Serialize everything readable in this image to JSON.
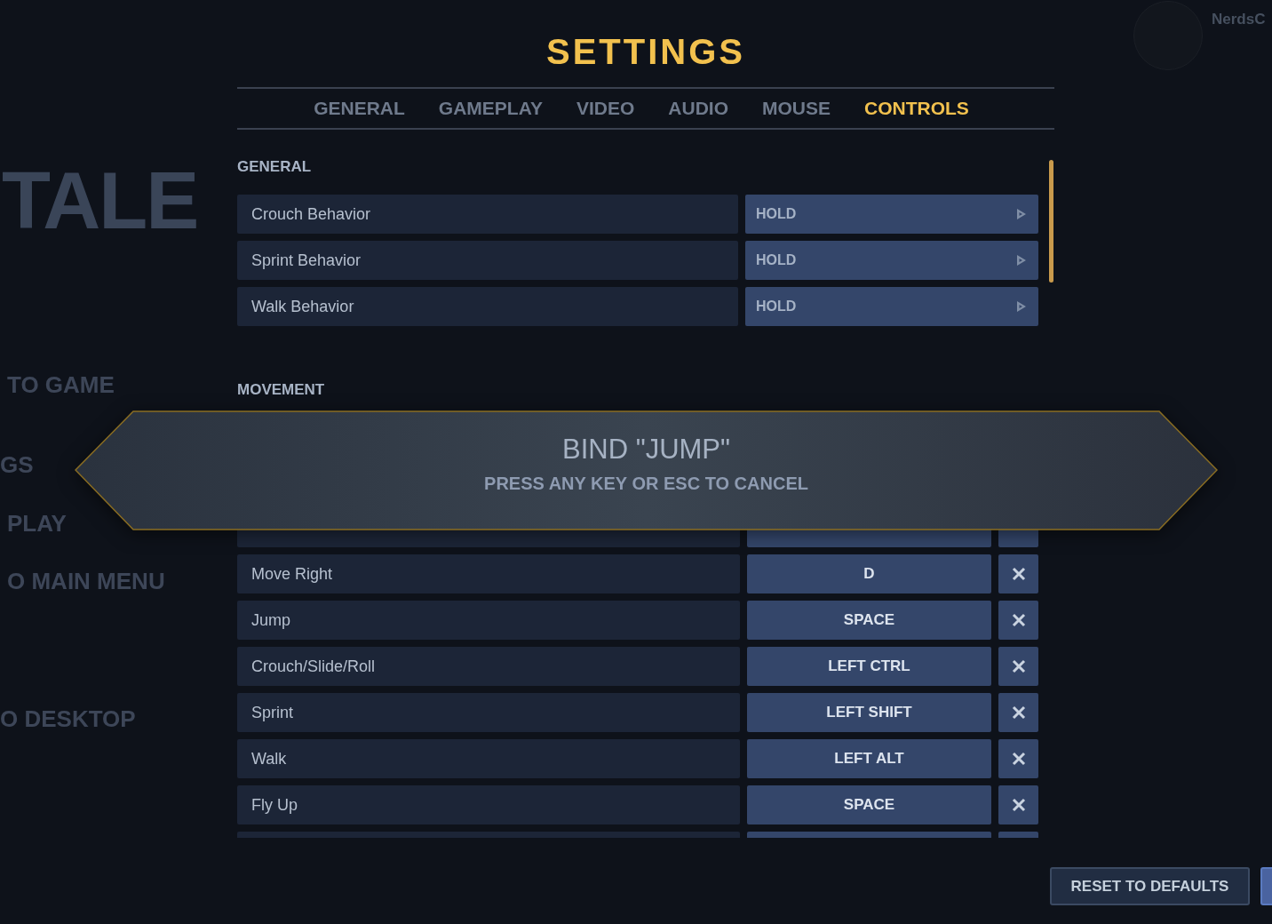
{
  "background": {
    "logo": "TALE",
    "menu": [
      "TO GAME",
      "GS",
      "PLAY",
      "O MAIN MENU",
      "O DESKTOP"
    ],
    "user": "NerdsC"
  },
  "title": "SETTINGS",
  "tabs": [
    {
      "label": "GENERAL",
      "selected": false
    },
    {
      "label": "GAMEPLAY",
      "selected": false
    },
    {
      "label": "VIDEO",
      "selected": false
    },
    {
      "label": "AUDIO",
      "selected": false
    },
    {
      "label": "MOUSE",
      "selected": false
    },
    {
      "label": "CONTROLS",
      "selected": true
    }
  ],
  "sections": [
    {
      "title": "GENERAL",
      "kind": "options",
      "rows": [
        {
          "label": "Crouch Behavior",
          "value": "HOLD"
        },
        {
          "label": "Sprint Behavior",
          "value": "HOLD"
        },
        {
          "label": "Walk Behavior",
          "value": "HOLD"
        }
      ]
    },
    {
      "title": "MOVEMENT",
      "kind": "keybinds",
      "rows": [
        {
          "label": "Move Right",
          "key": "D"
        },
        {
          "label": "Jump",
          "key": "SPACE"
        },
        {
          "label": "Crouch/Slide/Roll",
          "key": "LEFT CTRL"
        },
        {
          "label": "Sprint",
          "key": "LEFT SHIFT"
        },
        {
          "label": "Walk",
          "key": "LEFT ALT"
        },
        {
          "label": "Fly Up",
          "key": "SPACE"
        }
      ]
    }
  ],
  "dialog": {
    "title": "BIND \"JUMP\"",
    "message": "PRESS ANY KEY OR ESC TO CANCEL"
  },
  "buttons": [
    "RESET TO DEFAULTS"
  ]
}
